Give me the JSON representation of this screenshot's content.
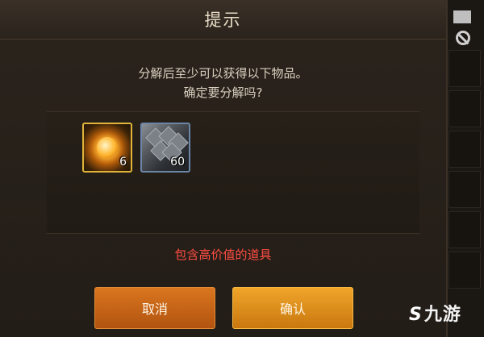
{
  "dialog": {
    "title": "提示",
    "message_line1": "分解后至少可以获得以下物品。",
    "message_line2": "确定要分解吗?",
    "items": [
      {
        "icon": "golden-orb-icon",
        "quantity": "6",
        "border_color": "#e0b43a"
      },
      {
        "icon": "grey-crystal-icon",
        "quantity": "60",
        "border_color": "#6d86a8"
      }
    ],
    "warning": "包含高价值的道具",
    "warning_color": "#ff4d43",
    "cancel_label": "取消",
    "confirm_label": "确认"
  },
  "sidebar": {
    "icons": [
      "flag-icon",
      "no-entry-icon"
    ]
  },
  "watermark": {
    "logo": "S",
    "text": "九游"
  }
}
